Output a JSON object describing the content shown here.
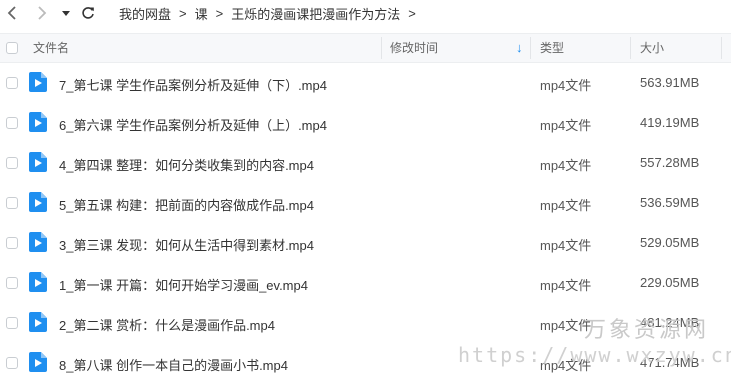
{
  "breadcrumb": {
    "items": [
      "我的网盘",
      "课",
      "王烁的漫画课把漫画作为方法"
    ],
    "separator": ">"
  },
  "header": {
    "name_label": "文件名",
    "modified_label": "修改时间",
    "type_label": "类型",
    "size_label": "大小",
    "sort_indicator": "↓"
  },
  "files": [
    {
      "name": "7_第七课 学生作品案例分析及延伸（下）.mp4",
      "type": "mp4文件",
      "size": "563.91MB"
    },
    {
      "name": "6_第六课 学生作品案例分析及延伸（上）.mp4",
      "type": "mp4文件",
      "size": "419.19MB"
    },
    {
      "name": "4_第四课 整理：如何分类收集到的内容.mp4",
      "type": "mp4文件",
      "size": "557.28MB"
    },
    {
      "name": "5_第五课 构建：把前面的内容做成作品.mp4",
      "type": "mp4文件",
      "size": "536.59MB"
    },
    {
      "name": "3_第三课 发现：如何从生活中得到素材.mp4",
      "type": "mp4文件",
      "size": "529.05MB"
    },
    {
      "name": "1_第一课 开篇：如何开始学习漫画_ev.mp4",
      "type": "mp4文件",
      "size": "229.05MB"
    },
    {
      "name": "2_第二课 赏析：什么是漫画作品.mp4",
      "type": "mp4文件",
      "size": "481.24MB"
    },
    {
      "name": "8_第八课 创作一本自己的漫画小书.mp4",
      "type": "mp4文件",
      "size": "471.74MB"
    }
  ],
  "watermark": {
    "line1": "万象资源网",
    "line2": "https://www.wxzyw.cn"
  },
  "colors": {
    "video_icon": "#1f8ff0",
    "sort_arrow": "#1f8ff0"
  },
  "icons": {
    "back": "chevron-left-icon",
    "forward": "chevron-right-icon",
    "dropdown": "caret-down-icon",
    "refresh": "refresh-icon",
    "file": "video-file-icon"
  }
}
